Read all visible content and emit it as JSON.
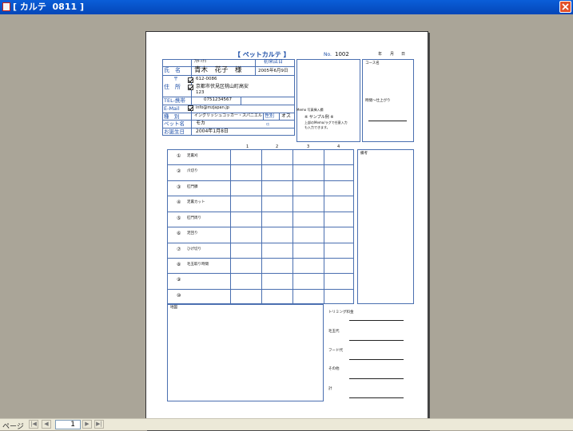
{
  "window": {
    "title": "[ カルテ  0811 ]"
  },
  "status": {
    "page_label": "ページ",
    "page_number": "1"
  },
  "form": {
    "heading": "【 ペットカルテ 】",
    "no_label": "No.",
    "no_value": "1002",
    "date_labels": [
      "年",
      "月",
      "日"
    ],
    "furigana": "ｱｵｷ ﾊﾅｺ",
    "first_visit_label": "初来店日",
    "name_label": "氏　名",
    "name_value": "青木　花子　様",
    "first_visit_value": "2005年6月9日",
    "postal_mark": "〒",
    "postal_value": "612-0086",
    "address_label": "住　所",
    "address_line1": "京都市伏見区桃山町高安",
    "address_line2": "123",
    "tel_label": "TEL-携帯",
    "tel_value": "0751234567",
    "email_label": "E-Mail",
    "email_value": "info@mzjapan.jp",
    "breed_label": "種　別",
    "breed_value": "イングリッシュコッカー・スパニエル",
    "sex_label": "性別",
    "sex_value": "オス",
    "pet_name_label": "ペット名",
    "pet_name_value": "モカ",
    "pet_name_small": "ﾓｶ",
    "birthday_label": "お誕生日",
    "birthday_value": "2004年1月8日",
    "memo_label": "Memo 写真挿入欄",
    "memo_note_line1": "※ サンプル例 ※",
    "memo_note_line2": "上部のMemo/ラグで任意入力",
    "memo_note_line3": "も入力できます。",
    "course_label": "コース名",
    "time_label": "時間～仕上がり",
    "remarks_label": "備考",
    "grid_columns": [
      "1",
      "2",
      "3",
      "4"
    ],
    "services": [
      {
        "num": "①",
        "label": "足裏刈"
      },
      {
        "num": "②",
        "label": "爪切り"
      },
      {
        "num": "③",
        "label": "肛門腺"
      },
      {
        "num": "④",
        "label": "足裏カット"
      },
      {
        "num": "⑤",
        "label": "肛門周り"
      },
      {
        "num": "⑥",
        "label": "足回り"
      },
      {
        "num": "⑦",
        "label": "ひげ切り"
      },
      {
        "num": "⑧",
        "label": "毛玉取り時間"
      },
      {
        "num": "⑨",
        "label": ""
      },
      {
        "num": "⑩",
        "label": ""
      }
    ],
    "map_label": "地図",
    "fees": [
      {
        "label": "トリミング料金"
      },
      {
        "label": "毛玉代"
      },
      {
        "label": "フード代"
      },
      {
        "label": "その他"
      },
      {
        "label": "計"
      }
    ]
  }
}
